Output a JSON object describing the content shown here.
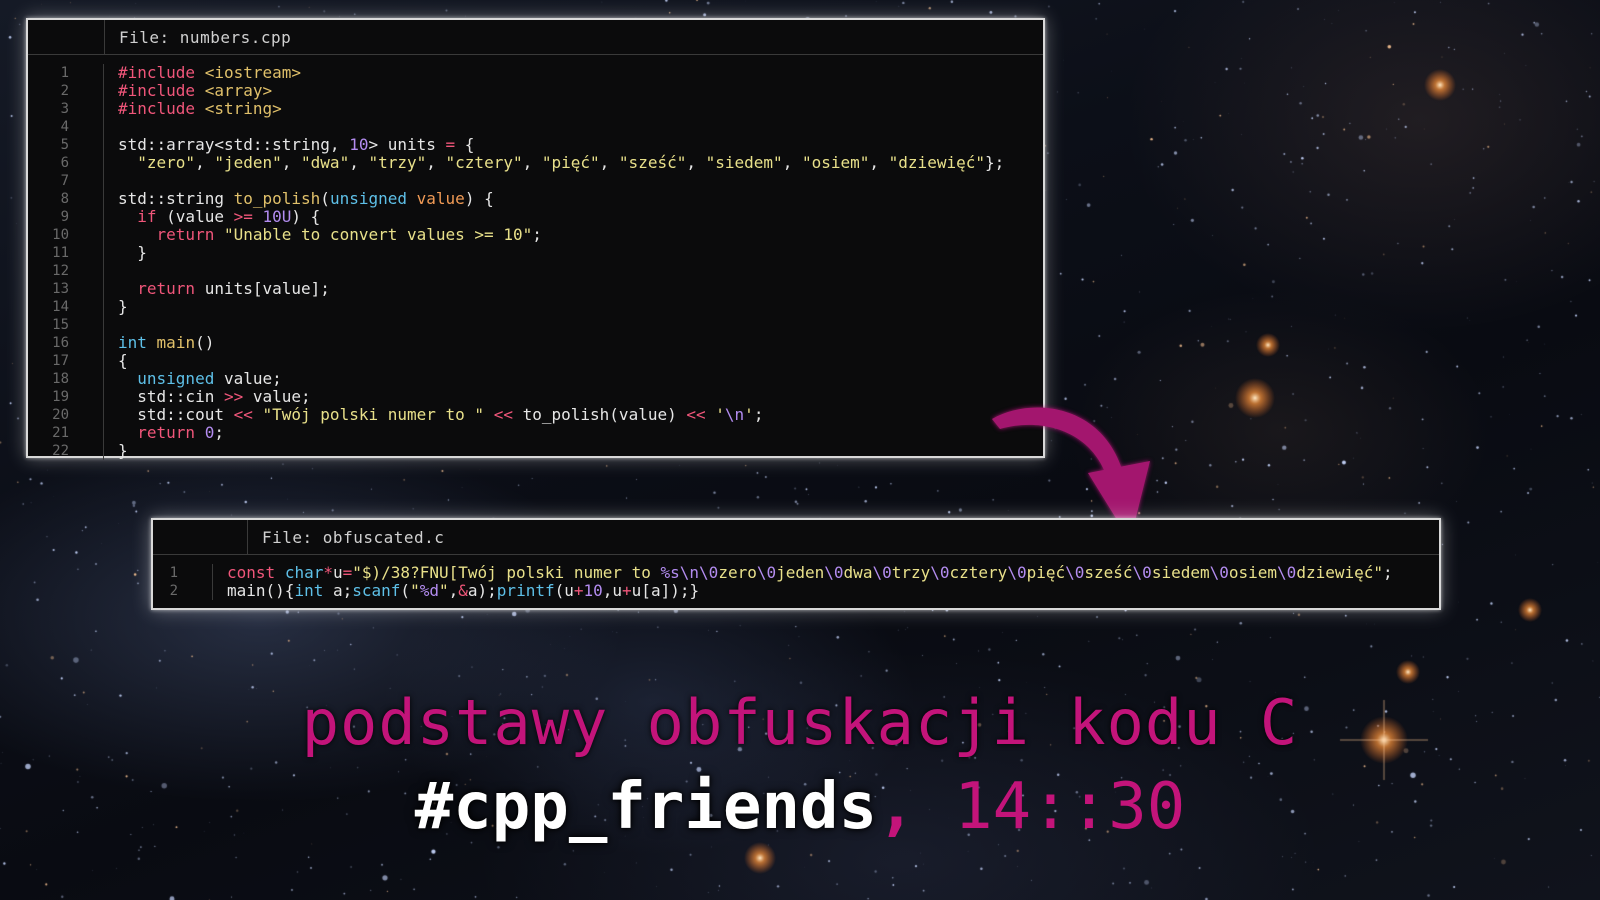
{
  "window1": {
    "file_label": "File: numbers.cpp",
    "line_numbers": [
      "1",
      "2",
      "3",
      "4",
      "5",
      "6",
      "7",
      "8",
      "9",
      "10",
      "11",
      "12",
      "13",
      "14",
      "15",
      "16",
      "17",
      "18",
      "19",
      "20",
      "21",
      "22"
    ],
    "code_lines": [
      [
        {
          "t": "#include",
          "c": "kw-pp"
        },
        {
          "t": " <iostream>",
          "c": "fn"
        }
      ],
      [
        {
          "t": "#include",
          "c": "kw-pp"
        },
        {
          "t": " <array>",
          "c": "fn"
        }
      ],
      [
        {
          "t": "#include",
          "c": "kw-pp"
        },
        {
          "t": " <string>",
          "c": "fn"
        }
      ],
      [
        {
          "t": "",
          "c": ""
        }
      ],
      [
        {
          "t": "std::array<std::string, ",
          "c": ""
        },
        {
          "t": "10",
          "c": "num"
        },
        {
          "t": "> units ",
          "c": ""
        },
        {
          "t": "=",
          "c": "op"
        },
        {
          "t": " {",
          "c": ""
        }
      ],
      [
        {
          "t": "  ",
          "c": ""
        },
        {
          "t": "\"zero\"",
          "c": "str"
        },
        {
          "t": ", ",
          "c": ""
        },
        {
          "t": "\"jeden\"",
          "c": "str"
        },
        {
          "t": ", ",
          "c": ""
        },
        {
          "t": "\"dwa\"",
          "c": "str"
        },
        {
          "t": ", ",
          "c": ""
        },
        {
          "t": "\"trzy\"",
          "c": "str"
        },
        {
          "t": ", ",
          "c": ""
        },
        {
          "t": "\"cztery\"",
          "c": "str"
        },
        {
          "t": ", ",
          "c": ""
        },
        {
          "t": "\"pięć\"",
          "c": "str"
        },
        {
          "t": ", ",
          "c": ""
        },
        {
          "t": "\"sześć\"",
          "c": "str"
        },
        {
          "t": ", ",
          "c": ""
        },
        {
          "t": "\"siedem\"",
          "c": "str"
        },
        {
          "t": ", ",
          "c": ""
        },
        {
          "t": "\"osiem\"",
          "c": "str"
        },
        {
          "t": ", ",
          "c": ""
        },
        {
          "t": "\"dziewięć\"",
          "c": "str"
        },
        {
          "t": "};",
          "c": ""
        }
      ],
      [
        {
          "t": "",
          "c": ""
        }
      ],
      [
        {
          "t": "std::string ",
          "c": ""
        },
        {
          "t": "to_polish",
          "c": "fn"
        },
        {
          "t": "(",
          "c": ""
        },
        {
          "t": "unsigned",
          "c": "kw-t"
        },
        {
          "t": " ",
          "c": ""
        },
        {
          "t": "value",
          "c": "parm"
        },
        {
          "t": ") {",
          "c": ""
        }
      ],
      [
        {
          "t": "  ",
          "c": ""
        },
        {
          "t": "if",
          "c": "kw-c"
        },
        {
          "t": " (value ",
          "c": ""
        },
        {
          "t": ">=",
          "c": "op"
        },
        {
          "t": " ",
          "c": ""
        },
        {
          "t": "10U",
          "c": "num"
        },
        {
          "t": ") {",
          "c": ""
        }
      ],
      [
        {
          "t": "    ",
          "c": ""
        },
        {
          "t": "return",
          "c": "kw-c"
        },
        {
          "t": " ",
          "c": ""
        },
        {
          "t": "\"Unable to convert values >= 10\"",
          "c": "str"
        },
        {
          "t": ";",
          "c": ""
        }
      ],
      [
        {
          "t": "  }",
          "c": ""
        }
      ],
      [
        {
          "t": "",
          "c": ""
        }
      ],
      [
        {
          "t": "  ",
          "c": ""
        },
        {
          "t": "return",
          "c": "kw-c"
        },
        {
          "t": " units[value];",
          "c": ""
        }
      ],
      [
        {
          "t": "}",
          "c": ""
        }
      ],
      [
        {
          "t": "",
          "c": ""
        }
      ],
      [
        {
          "t": "int",
          "c": "kw-t"
        },
        {
          "t": " ",
          "c": ""
        },
        {
          "t": "main",
          "c": "fn"
        },
        {
          "t": "()",
          "c": ""
        }
      ],
      [
        {
          "t": "{",
          "c": ""
        }
      ],
      [
        {
          "t": "  ",
          "c": ""
        },
        {
          "t": "unsigned",
          "c": "kw-t"
        },
        {
          "t": " value;",
          "c": ""
        }
      ],
      [
        {
          "t": "  std::cin ",
          "c": ""
        },
        {
          "t": ">>",
          "c": "op"
        },
        {
          "t": " value;",
          "c": ""
        }
      ],
      [
        {
          "t": "  std::cout ",
          "c": ""
        },
        {
          "t": "<<",
          "c": "op"
        },
        {
          "t": " ",
          "c": ""
        },
        {
          "t": "\"Twój polski numer to \"",
          "c": "str"
        },
        {
          "t": " ",
          "c": ""
        },
        {
          "t": "<<",
          "c": "op"
        },
        {
          "t": " to_polish(value) ",
          "c": ""
        },
        {
          "t": "<<",
          "c": "op"
        },
        {
          "t": " ",
          "c": ""
        },
        {
          "t": "'",
          "c": "str"
        },
        {
          "t": "\\n",
          "c": "esc"
        },
        {
          "t": "'",
          "c": "str"
        },
        {
          "t": ";",
          "c": ""
        }
      ],
      [
        {
          "t": "  ",
          "c": ""
        },
        {
          "t": "return",
          "c": "kw-c"
        },
        {
          "t": " ",
          "c": ""
        },
        {
          "t": "0",
          "c": "num"
        },
        {
          "t": ";",
          "c": ""
        }
      ],
      [
        {
          "t": "}",
          "c": ""
        }
      ]
    ]
  },
  "window2": {
    "file_label": "File: obfuscated.c",
    "line_numbers": [
      "1",
      "2"
    ],
    "code_lines": [
      [
        {
          "t": "const",
          "c": "kw-c"
        },
        {
          "t": " ",
          "c": ""
        },
        {
          "t": "char",
          "c": "kw-t"
        },
        {
          "t": "*",
          "c": "op"
        },
        {
          "t": "u",
          "c": ""
        },
        {
          "t": "=",
          "c": "op"
        },
        {
          "t": "\"$)/38?FNU[Twój polski numer to ",
          "c": "str"
        },
        {
          "t": "%s",
          "c": "esc"
        },
        {
          "t": "\\n\\0",
          "c": "esc"
        },
        {
          "t": "zero",
          "c": "str"
        },
        {
          "t": "\\0",
          "c": "esc"
        },
        {
          "t": "jeden",
          "c": "str"
        },
        {
          "t": "\\0",
          "c": "esc"
        },
        {
          "t": "dwa",
          "c": "str"
        },
        {
          "t": "\\0",
          "c": "esc"
        },
        {
          "t": "trzy",
          "c": "str"
        },
        {
          "t": "\\0",
          "c": "esc"
        },
        {
          "t": "cztery",
          "c": "str"
        },
        {
          "t": "\\0",
          "c": "esc"
        },
        {
          "t": "pięć",
          "c": "str"
        },
        {
          "t": "\\0",
          "c": "esc"
        },
        {
          "t": "sześć",
          "c": "str"
        },
        {
          "t": "\\0",
          "c": "esc"
        },
        {
          "t": "siedem",
          "c": "str"
        },
        {
          "t": "\\0",
          "c": "esc"
        },
        {
          "t": "osiem",
          "c": "str"
        },
        {
          "t": "\\0",
          "c": "esc"
        },
        {
          "t": "dziewięć\"",
          "c": "str"
        },
        {
          "t": ";",
          "c": ""
        }
      ],
      [
        {
          "t": "main(){",
          "c": ""
        },
        {
          "t": "int",
          "c": "kw-t"
        },
        {
          "t": " a;",
          "c": ""
        },
        {
          "t": "scanf",
          "c": "kw-t"
        },
        {
          "t": "(",
          "c": ""
        },
        {
          "t": "\"",
          "c": "str"
        },
        {
          "t": "%d",
          "c": "esc"
        },
        {
          "t": "\"",
          "c": "str"
        },
        {
          "t": ",",
          "c": ""
        },
        {
          "t": "&",
          "c": "op"
        },
        {
          "t": "a);",
          "c": ""
        },
        {
          "t": "printf",
          "c": "kw-t"
        },
        {
          "t": "(u",
          "c": ""
        },
        {
          "t": "+",
          "c": "op"
        },
        {
          "t": "10",
          "c": "num"
        },
        {
          "t": ",u",
          "c": ""
        },
        {
          "t": "+",
          "c": "op"
        },
        {
          "t": "u[a]);}",
          "c": ""
        }
      ]
    ]
  },
  "title": "podstawy obfuskacji kodu C",
  "tagline": {
    "hashtag": "#cpp_friends",
    "comma": ",",
    "time": " 14::30"
  },
  "colors": {
    "accent_magenta": "#c3147a",
    "arrow": "#a3156e",
    "preprocessor_keyword": "#f0567a",
    "type_keyword": "#5ec0e8",
    "function_name": "#e0c06a",
    "string": "#e8e08a",
    "number": "#b38cf0",
    "parameter": "#f09a55"
  },
  "icons": {
    "arrow": "curved-arrow-icon"
  }
}
